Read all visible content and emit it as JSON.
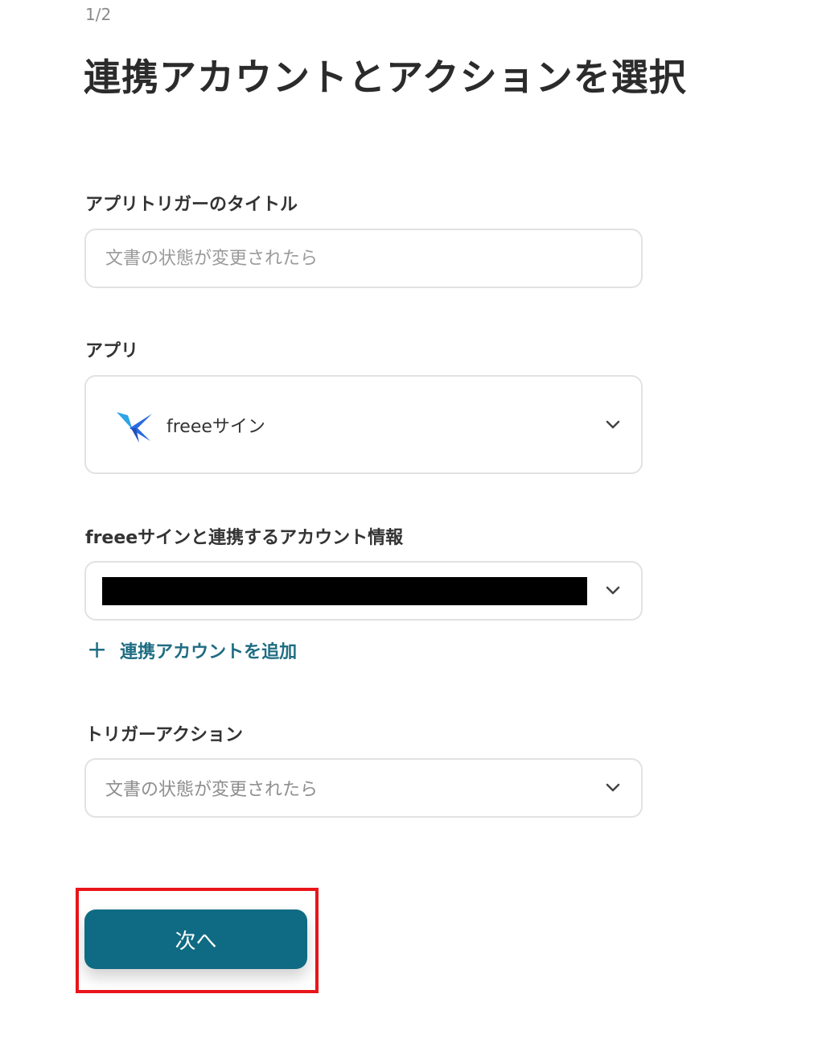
{
  "step_indicator": "1/2",
  "page_title": "連携アカウントとアクションを選択",
  "trigger_title": {
    "label": "アプリトリガーのタイトル",
    "value": "",
    "placeholder": "文書の状態が変更されたら"
  },
  "app": {
    "label": "アプリ",
    "selected": "freeeサイン",
    "logo_icon": "freee-sign-logo-icon"
  },
  "account": {
    "label": "freeeサインと連携するアカウント情報",
    "value_redacted": true,
    "add_link": "連携アカウントを追加"
  },
  "trigger_action": {
    "label": "トリガーアクション",
    "selected": "文書の状態が変更されたら"
  },
  "next_button": {
    "label": "次へ"
  },
  "colors": {
    "primary": "#0f6b83",
    "link": "#1f6d83",
    "highlight": "#e8151b"
  }
}
